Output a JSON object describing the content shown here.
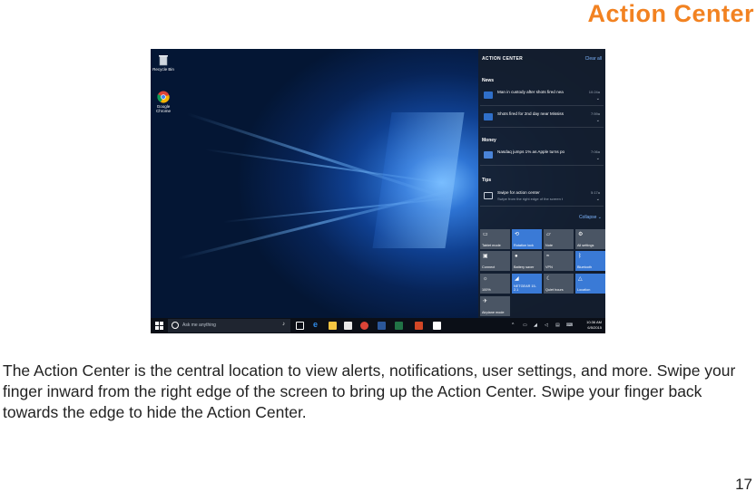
{
  "page": {
    "title": "Action Center",
    "page_number": "17",
    "body_text": "The Action Center is the central location to view alerts, notifications, user settings, and more. Swipe your finger inward from the right edge of the screen to bring up the Action Center. Swipe your finger back towards the edge to hide the Action Center."
  },
  "colors": {
    "title": "#f28221",
    "tile_on": "#3a7ad6",
    "tile_off": "#4a5564",
    "link": "#7eb6ff"
  },
  "desktop": {
    "recycle_bin": "Recycle Bin",
    "chrome": "Google Chrome"
  },
  "action_center": {
    "header": "ACTION CENTER",
    "clear_all": "Clear all",
    "collapse": "Collapse",
    "groups": {
      "news": "News",
      "money": "Money",
      "tips": "Tips"
    },
    "notifications": {
      "news1": {
        "text": "Man in custody after shots fired nea",
        "time": "10:24a"
      },
      "news2": {
        "text": "Shots fired for 2nd day near Mississ",
        "time": "7:59a"
      },
      "money1": {
        "text": "Nasdaq jumps 1% as Apple turns po",
        "time": "7:06a"
      },
      "tip1": {
        "text": "Swipe for action center",
        "sub": "Swipe from the right edge of the screen t",
        "time": "5:17a"
      }
    },
    "tiles": {
      "tablet_mode": "Tablet mode",
      "rotation_lock": "Rotation lock",
      "note": "Note",
      "all_settings": "All settings",
      "connect": "Connect",
      "battery_saver": "Battery saver",
      "vpn": "VPN",
      "bluetooth": "Bluetooth",
      "brightness": "100%",
      "network": "NETGEAR 15-2.1",
      "quiet_hours": "Quiet hours",
      "location": "Location",
      "airplane_mode": "Airplane mode"
    }
  },
  "taskbar": {
    "search_placeholder": "Ask me anything",
    "time": "10:36 AM",
    "date": "6/5/2015"
  }
}
